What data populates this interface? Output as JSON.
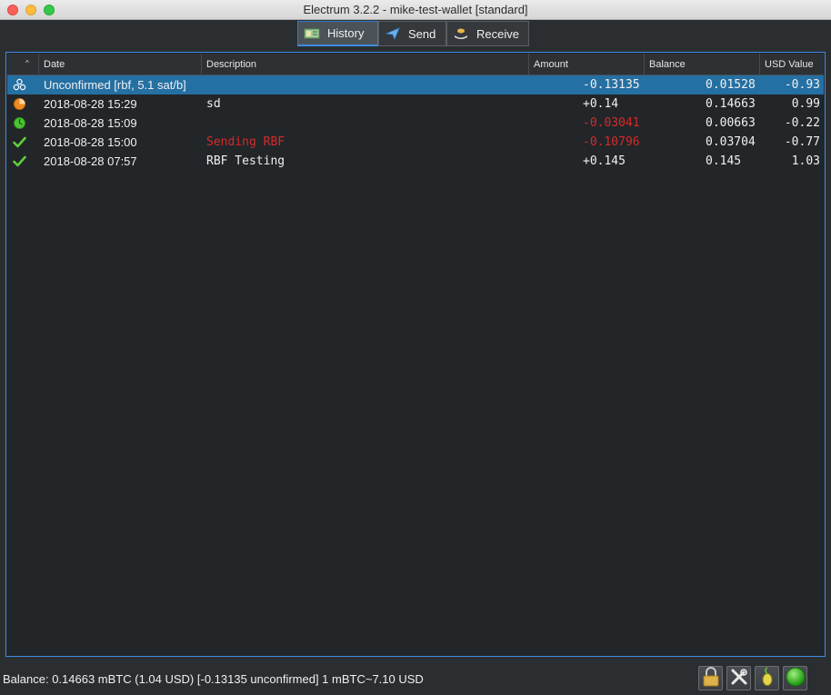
{
  "window": {
    "title": "Electrum 3.2.2  -  mike-test-wallet  [standard]"
  },
  "tabs": [
    {
      "label": "History",
      "icon": "history-icon",
      "active": true
    },
    {
      "label": "Send",
      "icon": "send-icon",
      "active": false
    },
    {
      "label": "Receive",
      "icon": "receive-icon",
      "active": false
    }
  ],
  "table": {
    "sort_indicator": "^",
    "columns": [
      "Date",
      "Description",
      "Amount",
      "Balance",
      "USD Value"
    ],
    "rows": [
      {
        "status_icon": "unconfirmed-icon",
        "date": "Unconfirmed [rbf, 5.1 sat/b]",
        "description": "",
        "amount": "-0.13135",
        "balance": "0.01528",
        "usd": "-0.93",
        "selected": true,
        "amount_red": false,
        "desc_red": false
      },
      {
        "status_icon": "clock-orange-icon",
        "date": "2018-08-28 15:29",
        "description": "sd",
        "amount": "+0.14",
        "balance": "0.14663",
        "usd": "0.99",
        "selected": false,
        "amount_red": false,
        "desc_red": false
      },
      {
        "status_icon": "clock-green-icon",
        "date": "2018-08-28 15:09",
        "description": "",
        "amount": "-0.03041",
        "balance": "0.00663",
        "usd": "-0.22",
        "selected": false,
        "amount_red": true,
        "desc_red": false
      },
      {
        "status_icon": "confirmed-check-icon",
        "date": "2018-08-28 15:00",
        "description": "Sending RBF",
        "amount": "-0.10796",
        "balance": "0.03704",
        "usd": "-0.77",
        "selected": false,
        "amount_red": true,
        "desc_red": true
      },
      {
        "status_icon": "confirmed-check-icon",
        "date": "2018-08-28 07:57",
        "description": "RBF Testing",
        "amount": "+0.145",
        "balance": "0.145",
        "usd": "1.03",
        "selected": false,
        "amount_red": false,
        "desc_red": false
      }
    ]
  },
  "status": {
    "text": "Balance: 0.14663 mBTC (1.04 USD)  [-0.13135 unconfirmed] 1 mBTC~7.10 USD",
    "buttons": [
      "lock-icon",
      "tools-icon",
      "seed-icon",
      "network-status-icon"
    ]
  },
  "colors": {
    "selection": "#2570a3",
    "accent": "#3d8ee3",
    "negative": "#d62a2a"
  }
}
